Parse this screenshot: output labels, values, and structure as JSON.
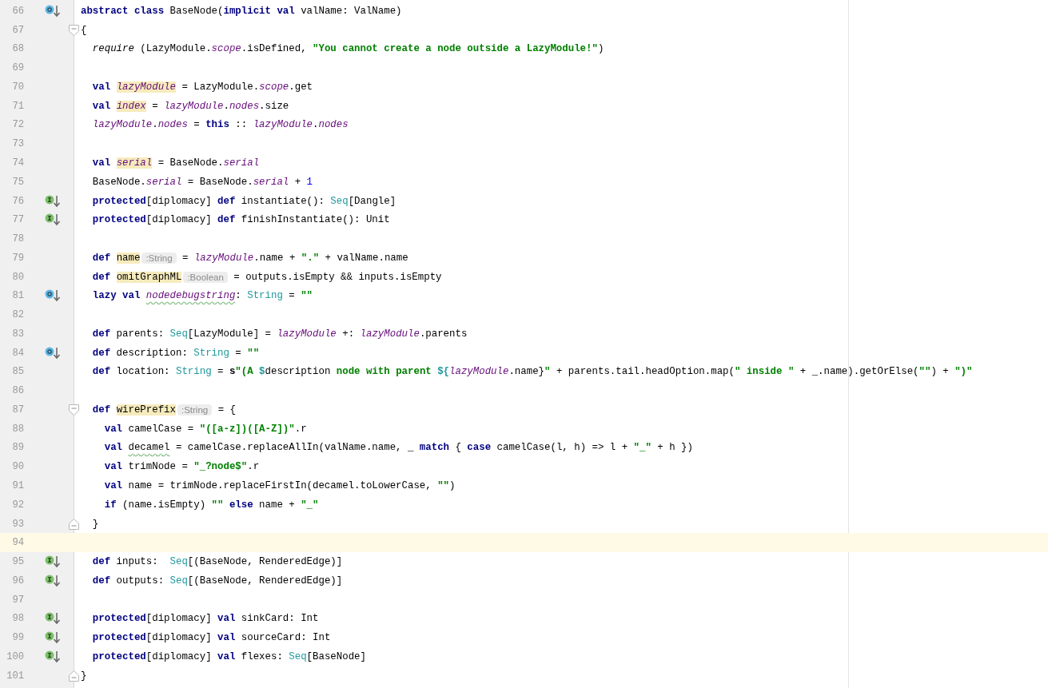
{
  "editor": {
    "lines": [
      {
        "number": "66",
        "overrides": true,
        "implements": false,
        "fold_start": false,
        "fold_end": false,
        "current": false,
        "tokens": [
          {
            "text": "abstract class ",
            "kind": "keyword"
          },
          {
            "text": "BaseNode(",
            "kind": "plain"
          },
          {
            "text": "implicit val ",
            "kind": "keyword"
          },
          {
            "text": "valName: ValName)",
            "kind": "plain"
          }
        ]
      },
      {
        "number": "67",
        "overrides": false,
        "implements": false,
        "fold_start": true,
        "fold_end": false,
        "current": false,
        "tokens": [
          {
            "text": "{",
            "kind": "plain"
          }
        ]
      },
      {
        "number": "68",
        "overrides": false,
        "implements": false,
        "fold_start": false,
        "fold_end": false,
        "current": false,
        "tokens": [
          {
            "text": "  require",
            "kind": "call"
          },
          {
            "text": " (LazyModule.",
            "kind": "plain"
          },
          {
            "text": "scope",
            "kind": "field"
          },
          {
            "text": ".isDefined, ",
            "kind": "plain"
          },
          {
            "text": "\"You cannot create a node outside a LazyModule!\"",
            "kind": "string"
          },
          {
            "text": ")",
            "kind": "plain"
          }
        ]
      },
      {
        "number": "69",
        "overrides": false,
        "implements": false,
        "fold_start": false,
        "fold_end": false,
        "current": false
      },
      {
        "number": "70",
        "overrides": false,
        "implements": false,
        "fold_start": false,
        "fold_end": false,
        "current": false,
        "tokens": [
          {
            "text": "  val ",
            "kind": "keyword"
          },
          {
            "text": "lazyModule",
            "kind": "field-mark"
          },
          {
            "text": " = LazyModule.",
            "kind": "plain"
          },
          {
            "text": "scope",
            "kind": "field"
          },
          {
            "text": ".get",
            "kind": "plain"
          }
        ]
      },
      {
        "number": "71",
        "overrides": false,
        "implements": false,
        "fold_start": false,
        "fold_end": false,
        "current": false,
        "tokens": [
          {
            "text": "  val ",
            "kind": "keyword"
          },
          {
            "text": "index",
            "kind": "field-mark"
          },
          {
            "text": " = ",
            "kind": "plain"
          },
          {
            "text": "lazyModule",
            "kind": "field"
          },
          {
            "text": ".",
            "kind": "plain"
          },
          {
            "text": "nodes",
            "kind": "field"
          },
          {
            "text": ".size",
            "kind": "plain"
          }
        ]
      },
      {
        "number": "72",
        "overrides": false,
        "implements": false,
        "fold_start": false,
        "fold_end": false,
        "current": false,
        "tokens": [
          {
            "text": "  lazyModule",
            "kind": "field"
          },
          {
            "text": ".",
            "kind": "plain"
          },
          {
            "text": "nodes",
            "kind": "field"
          },
          {
            "text": " = ",
            "kind": "plain"
          },
          {
            "text": "this",
            "kind": "keyword"
          },
          {
            "text": " :: ",
            "kind": "plain"
          },
          {
            "text": "lazyModule",
            "kind": "field"
          },
          {
            "text": ".",
            "kind": "plain"
          },
          {
            "text": "nodes",
            "kind": "field"
          }
        ]
      },
      {
        "number": "73",
        "overrides": false,
        "implements": false,
        "fold_start": false,
        "fold_end": false,
        "current": false
      },
      {
        "number": "74",
        "overrides": false,
        "implements": false,
        "fold_start": false,
        "fold_end": false,
        "current": false,
        "tokens": [
          {
            "text": "  val ",
            "kind": "keyword"
          },
          {
            "text": "serial",
            "kind": "field-mark"
          },
          {
            "text": " = BaseNode.",
            "kind": "plain"
          },
          {
            "text": "serial",
            "kind": "field"
          }
        ]
      },
      {
        "number": "75",
        "overrides": false,
        "implements": false,
        "fold_start": false,
        "fold_end": false,
        "current": false,
        "tokens": [
          {
            "text": "  BaseNode.",
            "kind": "plain"
          },
          {
            "text": "serial",
            "kind": "field"
          },
          {
            "text": " = BaseNode.",
            "kind": "plain"
          },
          {
            "text": "serial",
            "kind": "field"
          },
          {
            "text": " + ",
            "kind": "plain"
          },
          {
            "text": "1",
            "kind": "number"
          }
        ]
      },
      {
        "number": "76",
        "overrides": false,
        "implements": true,
        "fold_start": false,
        "fold_end": false,
        "current": false,
        "tokens": [
          {
            "text": "  protected",
            "kind": "keyword"
          },
          {
            "text": "[diplomacy] ",
            "kind": "plain"
          },
          {
            "text": "def",
            "kind": "keyword"
          },
          {
            "text": " instantiate(): ",
            "kind": "plain"
          },
          {
            "text": "Seq",
            "kind": "type"
          },
          {
            "text": "[Dangle]",
            "kind": "plain"
          }
        ]
      },
      {
        "number": "77",
        "overrides": false,
        "implements": true,
        "fold_start": false,
        "fold_end": false,
        "current": false,
        "tokens": [
          {
            "text": "  protected",
            "kind": "keyword"
          },
          {
            "text": "[diplomacy] ",
            "kind": "plain"
          },
          {
            "text": "def",
            "kind": "keyword"
          },
          {
            "text": " finishInstantiate(): Unit",
            "kind": "plain"
          }
        ]
      },
      {
        "number": "78",
        "overrides": false,
        "implements": false,
        "fold_start": false,
        "fold_end": false,
        "current": false
      },
      {
        "number": "79",
        "overrides": false,
        "implements": false,
        "fold_start": false,
        "fold_end": false,
        "current": false,
        "tokens": [
          {
            "text": "  def ",
            "kind": "keyword"
          },
          {
            "text": "name",
            "kind": "name-mark"
          },
          {
            "text": ":String",
            "kind": "hint"
          },
          {
            "text": " = ",
            "kind": "plain"
          },
          {
            "text": "lazyModule",
            "kind": "field"
          },
          {
            "text": ".name + ",
            "kind": "plain"
          },
          {
            "text": "\".\"",
            "kind": "string"
          },
          {
            "text": " + valName.name",
            "kind": "plain"
          }
        ]
      },
      {
        "number": "80",
        "overrides": false,
        "implements": false,
        "fold_start": false,
        "fold_end": false,
        "current": false,
        "tokens": [
          {
            "text": "  def ",
            "kind": "keyword"
          },
          {
            "text": "omitGraphML",
            "kind": "name-mark"
          },
          {
            "text": ":Boolean",
            "kind": "hint"
          },
          {
            "text": " = outputs.isEmpty && inputs.isEmpty",
            "kind": "plain"
          }
        ]
      },
      {
        "number": "81",
        "overrides": true,
        "implements": false,
        "fold_start": false,
        "fold_end": false,
        "current": false,
        "tokens": [
          {
            "text": "  lazy val ",
            "kind": "keyword"
          },
          {
            "text": "nodedebugstring",
            "kind": "field-typo"
          },
          {
            "text": ": ",
            "kind": "plain"
          },
          {
            "text": "String",
            "kind": "type"
          },
          {
            "text": " = ",
            "kind": "plain"
          },
          {
            "text": "\"\"",
            "kind": "string"
          }
        ]
      },
      {
        "number": "82",
        "overrides": false,
        "implements": false,
        "fold_start": false,
        "fold_end": false,
        "current": false
      },
      {
        "number": "83",
        "overrides": false,
        "implements": false,
        "fold_start": false,
        "fold_end": false,
        "current": false,
        "tokens": [
          {
            "text": "  def",
            "kind": "keyword"
          },
          {
            "text": " parents: ",
            "kind": "plain"
          },
          {
            "text": "Seq",
            "kind": "type"
          },
          {
            "text": "[LazyModule] = ",
            "kind": "plain"
          },
          {
            "text": "lazyModule",
            "kind": "field"
          },
          {
            "text": " +: ",
            "kind": "plain"
          },
          {
            "text": "lazyModule",
            "kind": "field"
          },
          {
            "text": ".parents",
            "kind": "plain"
          }
        ]
      },
      {
        "number": "84",
        "overrides": true,
        "implements": false,
        "fold_start": false,
        "fold_end": false,
        "current": false,
        "tokens": [
          {
            "text": "  def",
            "kind": "keyword"
          },
          {
            "text": " description: ",
            "kind": "plain"
          },
          {
            "text": "String",
            "kind": "type"
          },
          {
            "text": " = ",
            "kind": "plain"
          },
          {
            "text": "\"\"",
            "kind": "string"
          }
        ]
      },
      {
        "number": "85",
        "overrides": false,
        "implements": false,
        "fold_start": false,
        "fold_end": false,
        "current": false,
        "tokens": [
          {
            "text": "  def",
            "kind": "keyword"
          },
          {
            "text": " location: ",
            "kind": "plain"
          },
          {
            "text": "String",
            "kind": "type"
          },
          {
            "text": " = ",
            "kind": "plain"
          },
          {
            "text": "s",
            "kind": "interp"
          },
          {
            "text": "\"(A ",
            "kind": "string"
          },
          {
            "text": "$",
            "kind": "dollar"
          },
          {
            "text": "description",
            "kind": "plain"
          },
          {
            "text": " node with parent ",
            "kind": "string"
          },
          {
            "text": "${",
            "kind": "dollar"
          },
          {
            "text": "lazyModule",
            "kind": "field"
          },
          {
            "text": ".name}",
            "kind": "plain"
          },
          {
            "text": "\"",
            "kind": "string"
          },
          {
            "text": " + parents.tail.headOption.map(",
            "kind": "plain"
          },
          {
            "text": "\" inside \"",
            "kind": "string"
          },
          {
            "text": " + _.name).getOrElse(",
            "kind": "plain"
          },
          {
            "text": "\"\"",
            "kind": "string"
          },
          {
            "text": ") + ",
            "kind": "plain"
          },
          {
            "text": "\")\"",
            "kind": "string"
          }
        ]
      },
      {
        "number": "86",
        "overrides": false,
        "implements": false,
        "fold_start": false,
        "fold_end": false,
        "current": false
      },
      {
        "number": "87",
        "overrides": false,
        "implements": false,
        "fold_start": true,
        "fold_end": false,
        "current": false,
        "tokens": [
          {
            "text": "  def ",
            "kind": "keyword"
          },
          {
            "text": "wirePrefix",
            "kind": "name-mark"
          },
          {
            "text": ":String",
            "kind": "hint"
          },
          {
            "text": " = {",
            "kind": "plain"
          }
        ]
      },
      {
        "number": "88",
        "overrides": false,
        "implements": false,
        "fold_start": false,
        "fold_end": false,
        "current": false,
        "tokens": [
          {
            "text": "    val",
            "kind": "keyword"
          },
          {
            "text": " camelCase = ",
            "kind": "plain"
          },
          {
            "text": "\"([a-z])([A-Z])\"",
            "kind": "string"
          },
          {
            "text": ".r",
            "kind": "plain"
          }
        ]
      },
      {
        "number": "89",
        "overrides": false,
        "implements": false,
        "fold_start": false,
        "fold_end": false,
        "current": false,
        "tokens": [
          {
            "text": "    val ",
            "kind": "keyword"
          },
          {
            "text": "decamel",
            "kind": "plain-typo"
          },
          {
            "text": " = camelCase.replaceAllIn(valName.name, _ ",
            "kind": "plain"
          },
          {
            "text": "match",
            "kind": "keyword"
          },
          {
            "text": " { ",
            "kind": "plain"
          },
          {
            "text": "case",
            "kind": "keyword"
          },
          {
            "text": " camelCase(l, h) => l + ",
            "kind": "plain"
          },
          {
            "text": "\"_\"",
            "kind": "string"
          },
          {
            "text": " + h })",
            "kind": "plain"
          }
        ]
      },
      {
        "number": "90",
        "overrides": false,
        "implements": false,
        "fold_start": false,
        "fold_end": false,
        "current": false,
        "tokens": [
          {
            "text": "    val",
            "kind": "keyword"
          },
          {
            "text": " trimNode = ",
            "kind": "plain"
          },
          {
            "text": "\"_?node$\"",
            "kind": "string"
          },
          {
            "text": ".r",
            "kind": "plain"
          }
        ]
      },
      {
        "number": "91",
        "overrides": false,
        "implements": false,
        "fold_start": false,
        "fold_end": false,
        "current": false,
        "tokens": [
          {
            "text": "    val",
            "kind": "keyword"
          },
          {
            "text": " name = trimNode.replaceFirstIn(decamel.toLowerCase, ",
            "kind": "plain"
          },
          {
            "text": "\"\"",
            "kind": "string"
          },
          {
            "text": ")",
            "kind": "plain"
          }
        ]
      },
      {
        "number": "92",
        "overrides": false,
        "implements": false,
        "fold_start": false,
        "fold_end": false,
        "current": false,
        "tokens": [
          {
            "text": "    if",
            "kind": "keyword"
          },
          {
            "text": " (name.isEmpty) ",
            "kind": "plain"
          },
          {
            "text": "\"\"",
            "kind": "string"
          },
          {
            "text": " else",
            "kind": "keyword"
          },
          {
            "text": " name + ",
            "kind": "plain"
          },
          {
            "text": "\"_\"",
            "kind": "string"
          }
        ]
      },
      {
        "number": "93",
        "overrides": false,
        "implements": false,
        "fold_start": false,
        "fold_end": true,
        "current": false,
        "tokens": [
          {
            "text": "  }",
            "kind": "plain"
          }
        ]
      },
      {
        "number": "94",
        "overrides": false,
        "implements": false,
        "fold_start": false,
        "fold_end": false,
        "current": true
      },
      {
        "number": "95",
        "overrides": false,
        "implements": true,
        "fold_start": false,
        "fold_end": false,
        "current": false,
        "tokens": [
          {
            "text": "  def",
            "kind": "keyword"
          },
          {
            "text": " inputs:  ",
            "kind": "plain"
          },
          {
            "text": "Seq",
            "kind": "type"
          },
          {
            "text": "[(BaseNode, RenderedEdge)]",
            "kind": "plain"
          }
        ]
      },
      {
        "number": "96",
        "overrides": false,
        "implements": true,
        "fold_start": false,
        "fold_end": false,
        "current": false,
        "tokens": [
          {
            "text": "  def",
            "kind": "keyword"
          },
          {
            "text": " outputs: ",
            "kind": "plain"
          },
          {
            "text": "Seq",
            "kind": "type"
          },
          {
            "text": "[(BaseNode, RenderedEdge)]",
            "kind": "plain"
          }
        ]
      },
      {
        "number": "97",
        "overrides": false,
        "implements": false,
        "fold_start": false,
        "fold_end": false,
        "current": false
      },
      {
        "number": "98",
        "overrides": false,
        "implements": true,
        "fold_start": false,
        "fold_end": false,
        "current": false,
        "tokens": [
          {
            "text": "  protected",
            "kind": "keyword"
          },
          {
            "text": "[diplomacy] ",
            "kind": "plain"
          },
          {
            "text": "val",
            "kind": "keyword"
          },
          {
            "text": " sinkCard: Int",
            "kind": "plain"
          }
        ]
      },
      {
        "number": "99",
        "overrides": false,
        "implements": true,
        "fold_start": false,
        "fold_end": false,
        "current": false,
        "tokens": [
          {
            "text": "  protected",
            "kind": "keyword"
          },
          {
            "text": "[diplomacy] ",
            "kind": "plain"
          },
          {
            "text": "val",
            "kind": "keyword"
          },
          {
            "text": " sourceCard: Int",
            "kind": "plain"
          }
        ]
      },
      {
        "number": "100",
        "overrides": false,
        "implements": true,
        "fold_start": false,
        "fold_end": false,
        "current": false,
        "tokens": [
          {
            "text": "  protected",
            "kind": "keyword"
          },
          {
            "text": "[diplomacy] ",
            "kind": "plain"
          },
          {
            "text": "val",
            "kind": "keyword"
          },
          {
            "text": " flexes: ",
            "kind": "plain"
          },
          {
            "text": "Seq",
            "kind": "type"
          },
          {
            "text": "[BaseNode]",
            "kind": "plain"
          }
        ]
      },
      {
        "number": "101",
        "overrides": false,
        "implements": false,
        "fold_start": false,
        "fold_end": true,
        "current": false,
        "tokens": [
          {
            "text": "}",
            "kind": "plain"
          }
        ]
      }
    ]
  }
}
